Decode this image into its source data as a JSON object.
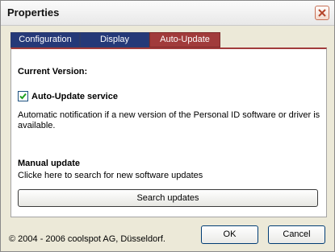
{
  "window": {
    "title": "Properties"
  },
  "tabs": [
    {
      "label": "Configuration",
      "active": false
    },
    {
      "label": "Display",
      "active": false
    },
    {
      "label": "Auto-Update",
      "active": true
    }
  ],
  "panel": {
    "current_version_label": "Current Version:",
    "auto_update": {
      "label": "Auto-Update service",
      "checked": true
    },
    "notification_text_line1": "Automatic notification if a new version of the Personal ID software or driver is",
    "notification_text_line2": "available.",
    "manual_update_heading": "Manual update",
    "manual_update_text": "Clicke here to search for  new software updates",
    "search_button_label": "Search updates"
  },
  "footer": {
    "copyright": "© 2004 - 2006 coolspot AG, Düsseldorf."
  },
  "buttons": {
    "ok_label": "OK",
    "cancel_label": "Cancel"
  },
  "colors": {
    "tab_inactive": "#253978",
    "tab_active": "#a13b3b",
    "dialog_bg": "#ece9d8"
  }
}
